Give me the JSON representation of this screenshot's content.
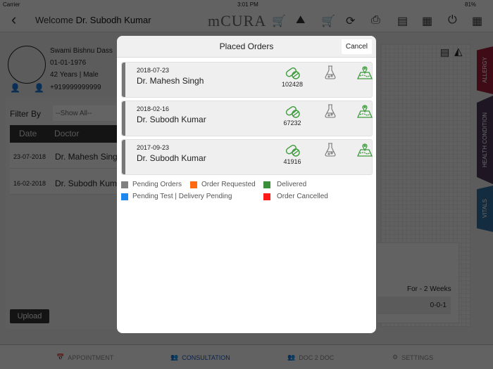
{
  "status": {
    "carrier": "Carrier",
    "time": "3:01 PM",
    "battery": "81%"
  },
  "header": {
    "welcome": "Welcome",
    "doctor": "Dr. Subodh Kumar",
    "logo": "mCURA"
  },
  "patient": {
    "name": "Swami Bishnu Dass",
    "dob": "01-01-1976",
    "age_gender": "42 Years | Male",
    "phone": "+919999999999"
  },
  "filter": {
    "label": "Filter By",
    "value": "--Show All--"
  },
  "table": {
    "headers": [
      "Date",
      "Doctor"
    ],
    "rows": [
      {
        "date": "23-07-2018",
        "doctor": "Dr. Mahesh Singh"
      },
      {
        "date": "16-02-2018",
        "doctor": "Dr. Subodh Kumar"
      }
    ]
  },
  "upload": "Upload",
  "right": {
    "duration": "For - 2 Weeks",
    "dosage": "0-0-1"
  },
  "side_tabs": [
    {
      "label": "ALLERGY",
      "color": "#9b1b3a"
    },
    {
      "label": "HEALTH CONDITION",
      "color": "#4a3658"
    },
    {
      "label": "VITALS",
      "color": "#2f6e9e"
    }
  ],
  "tabbar": [
    {
      "label": "APPOINTMENT"
    },
    {
      "label": "CONSULTATION",
      "active": true
    },
    {
      "label": "DOC 2 DOC"
    },
    {
      "label": "SETTINGS"
    }
  ],
  "modal": {
    "title": "Placed Orders",
    "cancel": "Cancel",
    "orders": [
      {
        "date": "2018-07-23",
        "doctor": "Dr. Mahesh Singh",
        "order_no": "102428"
      },
      {
        "date": "2018-02-16",
        "doctor": "Dr. Subodh Kumar",
        "order_no": "67232"
      },
      {
        "date": "2017-09-23",
        "doctor": "Dr. Subodh Kumar",
        "order_no": "41916"
      }
    ],
    "legend": [
      {
        "label": "Pending Orders",
        "color": "#808080"
      },
      {
        "label": "Order Requested",
        "color": "#ff6a13"
      },
      {
        "label": "Delivered",
        "color": "#3b8f3b"
      },
      {
        "label": "Pending Test | Delivery Pending",
        "color": "#1e88f0"
      },
      {
        "label": "Order Cancelled",
        "color": "#ff1a1a"
      }
    ]
  }
}
